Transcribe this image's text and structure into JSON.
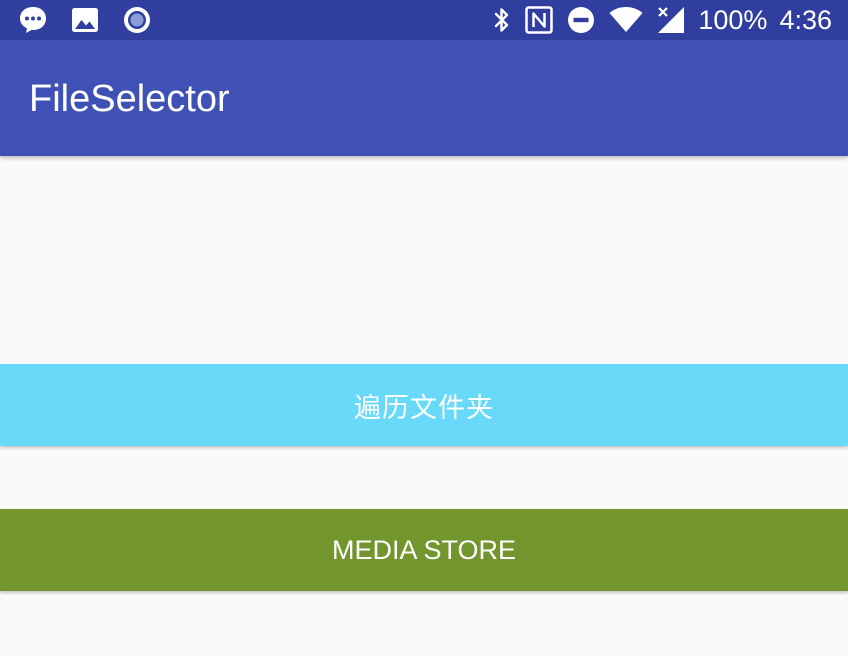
{
  "status_bar": {
    "left_icons": [
      "message-icon",
      "image-icon",
      "radio-circle-icon"
    ],
    "right_icons": [
      "bluetooth-icon",
      "nfc-icon",
      "do-not-disturb-icon",
      "wifi-icon",
      "signal-icon"
    ],
    "battery": "100%",
    "time": "4:36",
    "background_color": "#303f9f"
  },
  "app_bar": {
    "title": "FileSelector",
    "background_color": "#3f51b5"
  },
  "main": {
    "traverse_button_label": "遍历文件夹",
    "traverse_button_color": "#68d9f8",
    "media_store_button_label": "MEDIA STORE",
    "media_store_button_color": "#72952e"
  }
}
